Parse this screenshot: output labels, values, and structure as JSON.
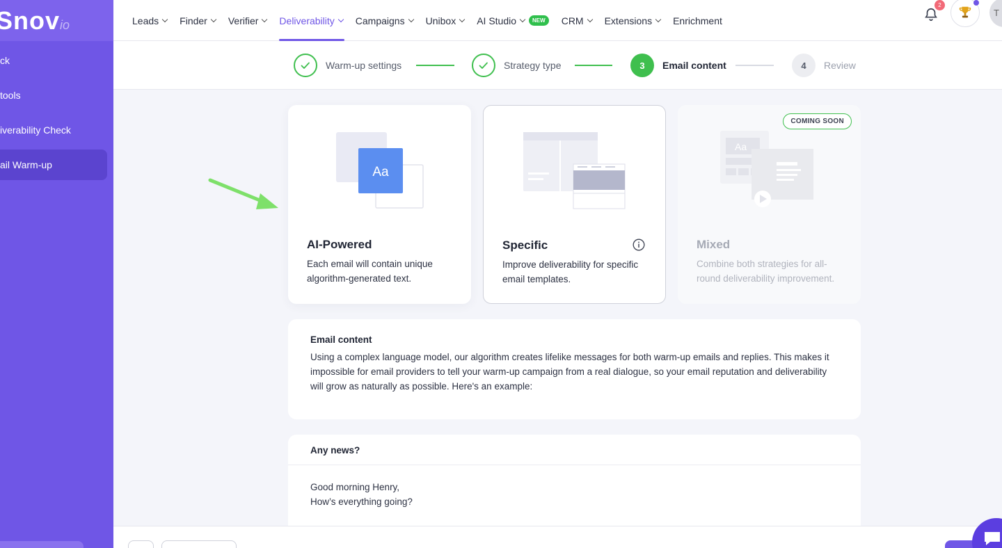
{
  "sidebar": {
    "logo": "Snov",
    "logo_suffix": "io",
    "items": [
      {
        "label": "ck"
      },
      {
        "label": "tools"
      },
      {
        "label": "iverability Check"
      },
      {
        "label": "ail Warm-up",
        "active": true
      }
    ]
  },
  "nav": {
    "items": [
      {
        "label": "Leads"
      },
      {
        "label": "Finder"
      },
      {
        "label": "Verifier"
      },
      {
        "label": "Deliverability",
        "active": true
      },
      {
        "label": "Campaigns"
      },
      {
        "label": "Unibox"
      },
      {
        "label": "AI Studio",
        "badge": "NEW"
      },
      {
        "label": "CRM"
      },
      {
        "label": "Extensions"
      },
      {
        "label": "Enrichment"
      }
    ],
    "notification_count": "2",
    "avatar_initial": "T"
  },
  "stepper": {
    "steps": [
      {
        "label": "Warm-up settings",
        "state": "done"
      },
      {
        "label": "Strategy type",
        "state": "done"
      },
      {
        "label": "Email content",
        "number": "3",
        "state": "current"
      },
      {
        "label": "Review",
        "number": "4",
        "state": "todo"
      }
    ]
  },
  "strategies": [
    {
      "title": "AI-Powered",
      "description": "Each email will contain unique algorithm-generated text.",
      "thumbnail_text": "Aa"
    },
    {
      "title": "Specific",
      "description": "Improve deliverability for specific email templates."
    },
    {
      "title": "Mixed",
      "description": "Combine both strategies for all-round deliverability improvement.",
      "badge": "COMING SOON",
      "thumbnail_text": "Aa"
    }
  ],
  "email_content": {
    "title": "Email content",
    "text": "Using a complex language model, our algorithm creates lifelike messages for both warm-up emails and replies. This makes it impossible for email providers to tell your warm-up campaign from a real dialogue, so your email reputation and deliverability will grow as naturally as possible. Here's an example:"
  },
  "example_email": {
    "subject": "Any news?",
    "line1": "Good morning Henry,",
    "line2": "How’s everything going?"
  },
  "colors": {
    "brand": "#6f56e6",
    "success": "#3fbf4e",
    "arrow": "#7ee06a"
  }
}
